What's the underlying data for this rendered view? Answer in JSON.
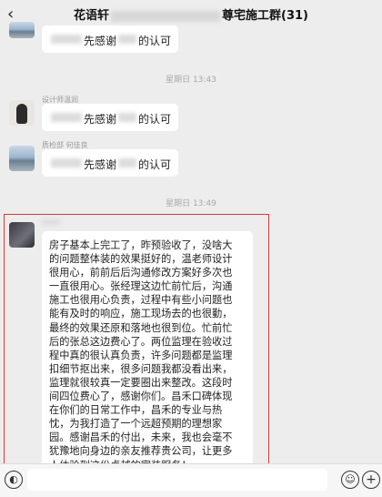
{
  "header": {
    "back_glyph": "‹",
    "title_start": "花语轩",
    "title_end": "尊宅施工群(31)"
  },
  "times": [
    "星期日 13:43",
    "星期日 13:49"
  ],
  "messages": [
    {
      "text_a": "先感谢",
      "text_b": "的认可"
    },
    {
      "sender": "设计师温润",
      "text_a": "先感谢",
      "text_b": "的认可"
    },
    {
      "sender": "质检部 何佳良",
      "text_a": "先感谢",
      "text_b": "的认可"
    }
  ],
  "long_message_lines": [
    "房子基本上完工了，昨预验收了，没啥大",
    "的问题整体装的效果挺好的，温老师设计",
    "很用心，前前后后沟通修改方案好多次也",
    "一直很用心。张经理这边忙前忙后，沟通",
    "施工也很用心负责，过程中有些小问题也",
    "能有及时的响应，施工现场去的也很勤，",
    "最终的效果还原和落地也很到位。忙前忙",
    "后的张总这边费心了。两位监理在验收过",
    "程中真的很认真负责，许多问题都是监理",
    "扣细节抠出来，很多问题我都没看出来，",
    "监理就很较真一定要圈出来整改。这段时",
    "间四位费心了，感谢你们。昌禾口碑体现",
    "在你们的日常工作中，昌禾的专业与热",
    "忱，为我打造了一个远超预期的理想家",
    "园。感谢昌禾的付出，未来，我也会毫不",
    "犹豫地向身边的亲友推荐贵公司，让更多",
    "人体验到这份卓越的家装服务！"
  ],
  "bottom": {
    "voice_glyph": "◐",
    "emoji_glyph": "☺",
    "plus_glyph": "+"
  },
  "colors": {
    "background": "#ededed",
    "bubble": "#ffffff",
    "highlight": "#d63c3c"
  }
}
